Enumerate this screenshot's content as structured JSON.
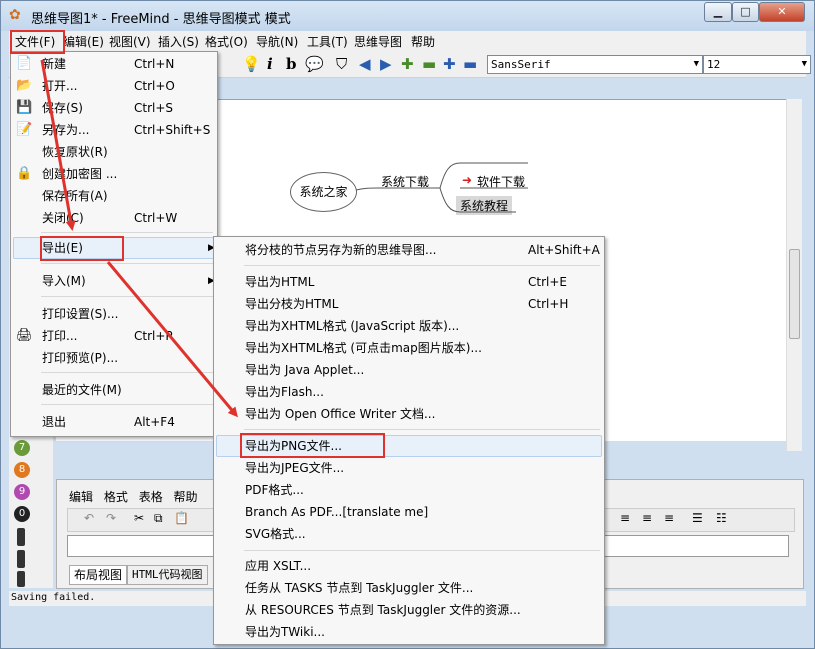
{
  "window": {
    "title": "思维导图1* - FreeMind - 思维导图模式 模式",
    "minimize": "▁",
    "maximize": "□",
    "close": "✕"
  },
  "menubar": [
    "文件(F)",
    "编辑(E)",
    "视图(V)",
    "插入(S)",
    "格式(O)",
    "导航(N)",
    "工具(T)",
    "思维导图",
    "帮助"
  ],
  "toolbar": {
    "font": "SansSerif",
    "size": "12"
  },
  "mindmap": {
    "root": "系统之家",
    "branch": "系统下载",
    "child1": "软件下载",
    "child2": "系统教程"
  },
  "file_menu": [
    {
      "label": "新建",
      "shortcut": "Ctrl+N"
    },
    {
      "label": "打开...",
      "shortcut": "Ctrl+O"
    },
    {
      "label": "保存(S)",
      "shortcut": "Ctrl+S"
    },
    {
      "label": "另存为...",
      "shortcut": "Ctrl+Shift+S"
    },
    {
      "label": "恢复原状(R)",
      "shortcut": ""
    },
    {
      "label": "创建加密图 ...",
      "shortcut": ""
    },
    {
      "label": "保存所有(A)",
      "shortcut": ""
    },
    {
      "label": "关闭(C)",
      "shortcut": "Ctrl+W"
    },
    {
      "label": "导出(E)",
      "shortcut": ""
    },
    {
      "label": "导入(M)",
      "shortcut": ""
    },
    {
      "label": "打印设置(S)...",
      "shortcut": ""
    },
    {
      "label": "打印...",
      "shortcut": "Ctrl+P"
    },
    {
      "label": "打印预览(P)...",
      "shortcut": ""
    },
    {
      "label": "最近的文件(M)",
      "shortcut": ""
    },
    {
      "label": "退出",
      "shortcut": "Alt+F4"
    }
  ],
  "export_menu": [
    {
      "label": "将分枝的节点另存为新的思维导图...",
      "shortcut": "Alt+Shift+A"
    },
    {
      "label": "导出为HTML",
      "shortcut": "Ctrl+E"
    },
    {
      "label": "导出分枝为HTML",
      "shortcut": "Ctrl+H"
    },
    {
      "label": "导出为XHTML格式 (JavaScript 版本)...",
      "shortcut": ""
    },
    {
      "label": "导出为XHTML格式 (可点击map图片版本)...",
      "shortcut": ""
    },
    {
      "label": "导出为 Java Applet...",
      "shortcut": ""
    },
    {
      "label": "导出为Flash...",
      "shortcut": ""
    },
    {
      "label": "导出为 Open Office Writer 文档...",
      "shortcut": ""
    },
    {
      "label": "导出为PNG文件...",
      "shortcut": ""
    },
    {
      "label": "导出为JPEG文件...",
      "shortcut": ""
    },
    {
      "label": "PDF格式...",
      "shortcut": ""
    },
    {
      "label": "Branch As PDF...[translate me]",
      "shortcut": ""
    },
    {
      "label": "SVG格式...",
      "shortcut": ""
    },
    {
      "label": "应用 XSLT...",
      "shortcut": ""
    },
    {
      "label": "任务从 TASKS 节点到 TaskJuggler 文件...",
      "shortcut": ""
    },
    {
      "label": "从 RESOURCES 节点到 TaskJuggler 文件的资源...",
      "shortcut": ""
    },
    {
      "label": "导出为TWiki...",
      "shortcut": ""
    }
  ],
  "notes": {
    "menu": [
      "编辑",
      "格式",
      "表格",
      "帮助"
    ],
    "tab1": "布局视图",
    "tab2": "HTML代码视图"
  },
  "status": "Saving failed.",
  "colors": {
    "highlight": "#e0322d",
    "menu_bg": "#f7f7f7"
  }
}
